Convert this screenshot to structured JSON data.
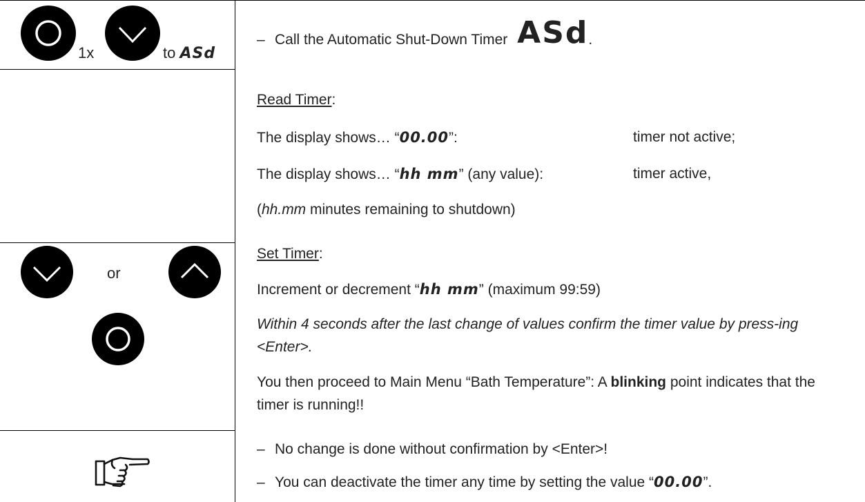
{
  "left": {
    "press_count": "1x",
    "to_label": "to",
    "asd_code": "ASd",
    "or_label": "or"
  },
  "step1": {
    "dash": "–",
    "text": "Call the Automatic Shut-Down Timer",
    "code": "ASd",
    "period": "."
  },
  "read_timer": {
    "heading": "Read Timer",
    "colon": ":",
    "row1_prefix": "The display shows… “",
    "row1_code": "00.00",
    "row1_suffix": "”:",
    "row1_status": "timer not active;",
    "row2_prefix": "The display shows… “",
    "row2_code": "hh mm",
    "row2_suffix": "” (any value):",
    "row2_status": "timer active,",
    "note_open": "(",
    "note_italic": "hh.mm",
    "note_rest": " minutes remaining to shutdown)"
  },
  "set_timer": {
    "heading": "Set Timer",
    "colon": ":",
    "inc_prefix": "Increment or decrement “",
    "inc_code": "hh mm",
    "inc_suffix": "” (maximum 99:59)",
    "confirm_italic": "Within 4 seconds after the last change of values confirm the timer value by press-ing <Enter>.",
    "proceed_before": "You then proceed to Main Menu “Bath Temperature”: A ",
    "proceed_bold": "blinking",
    "proceed_after": " point indicates that the timer is running!!"
  },
  "notes": {
    "dash": "–",
    "note1": "No change is done without confirmation by <Enter>!",
    "note2_prefix": "You can deactivate the timer any time by setting the value “",
    "note2_code": "00.00",
    "note2_suffix": "”."
  },
  "icons": [
    "enter-button-icon",
    "down-arrow-button-icon",
    "up-arrow-button-icon",
    "pointing-hand-icon"
  ],
  "colors": {
    "button": "#000000",
    "text": "#222222",
    "rule": "#000000"
  }
}
